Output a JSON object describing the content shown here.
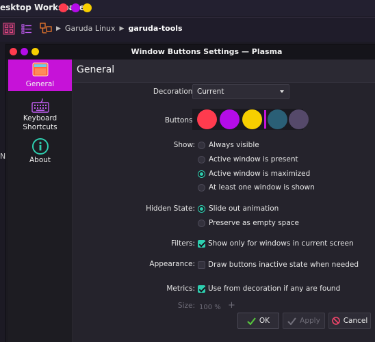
{
  "desktop": {
    "title": "esktop Workspace",
    "dots": [
      "#ff3b4e",
      "#b40ce8",
      "#f7cf00"
    ],
    "breadcrumb": {
      "first": "Garuda Linux",
      "second": "garuda-tools"
    },
    "partial_text": "N"
  },
  "window": {
    "title": "Window Buttons Settings — Plasma",
    "dots": [
      "#ff3b4e",
      "#b40ce8",
      "#f7cf00"
    ]
  },
  "sidebar": {
    "items": [
      {
        "label": "General",
        "icon": "general-settings-icon",
        "active": true
      },
      {
        "label": "Keyboard\nShortcuts",
        "icon": "keyboard-icon",
        "active": false
      },
      {
        "label": "About",
        "icon": "info-icon",
        "active": false
      }
    ]
  },
  "page": {
    "heading": "General",
    "decoration": {
      "label": "Decoration:",
      "value": "Current"
    },
    "buttons": {
      "label": "Buttons:",
      "colors": [
        "#ff3b4e",
        "#b40ce8",
        "#f7cf00",
        "#2a5f76",
        "#55496a"
      ]
    },
    "show": {
      "label": "Show:",
      "options": [
        "Always visible",
        "Active window is present",
        "Active window is maximized",
        "At least one window is shown"
      ],
      "selected": 2
    },
    "hidden_state": {
      "label": "Hidden State:",
      "options": [
        "Slide out animation",
        "Preserve as empty space"
      ],
      "selected": 0
    },
    "filters": {
      "label": "Filters:",
      "option": "Show only for windows in current screen",
      "checked": true
    },
    "appearance": {
      "label": "Appearance:",
      "option": "Draw buttons inactive state when needed",
      "checked": false
    },
    "metrics": {
      "label": "Metrics:",
      "option": "Use from decoration if any are found",
      "checked": true
    },
    "size": {
      "label": "Size:",
      "value": "100 %"
    }
  },
  "dialog_buttons": {
    "ok": "OK",
    "apply": "Apply",
    "cancel": "Cancel"
  },
  "colors": {
    "accent": "#c612d8",
    "teal": "#2ecfb0"
  }
}
